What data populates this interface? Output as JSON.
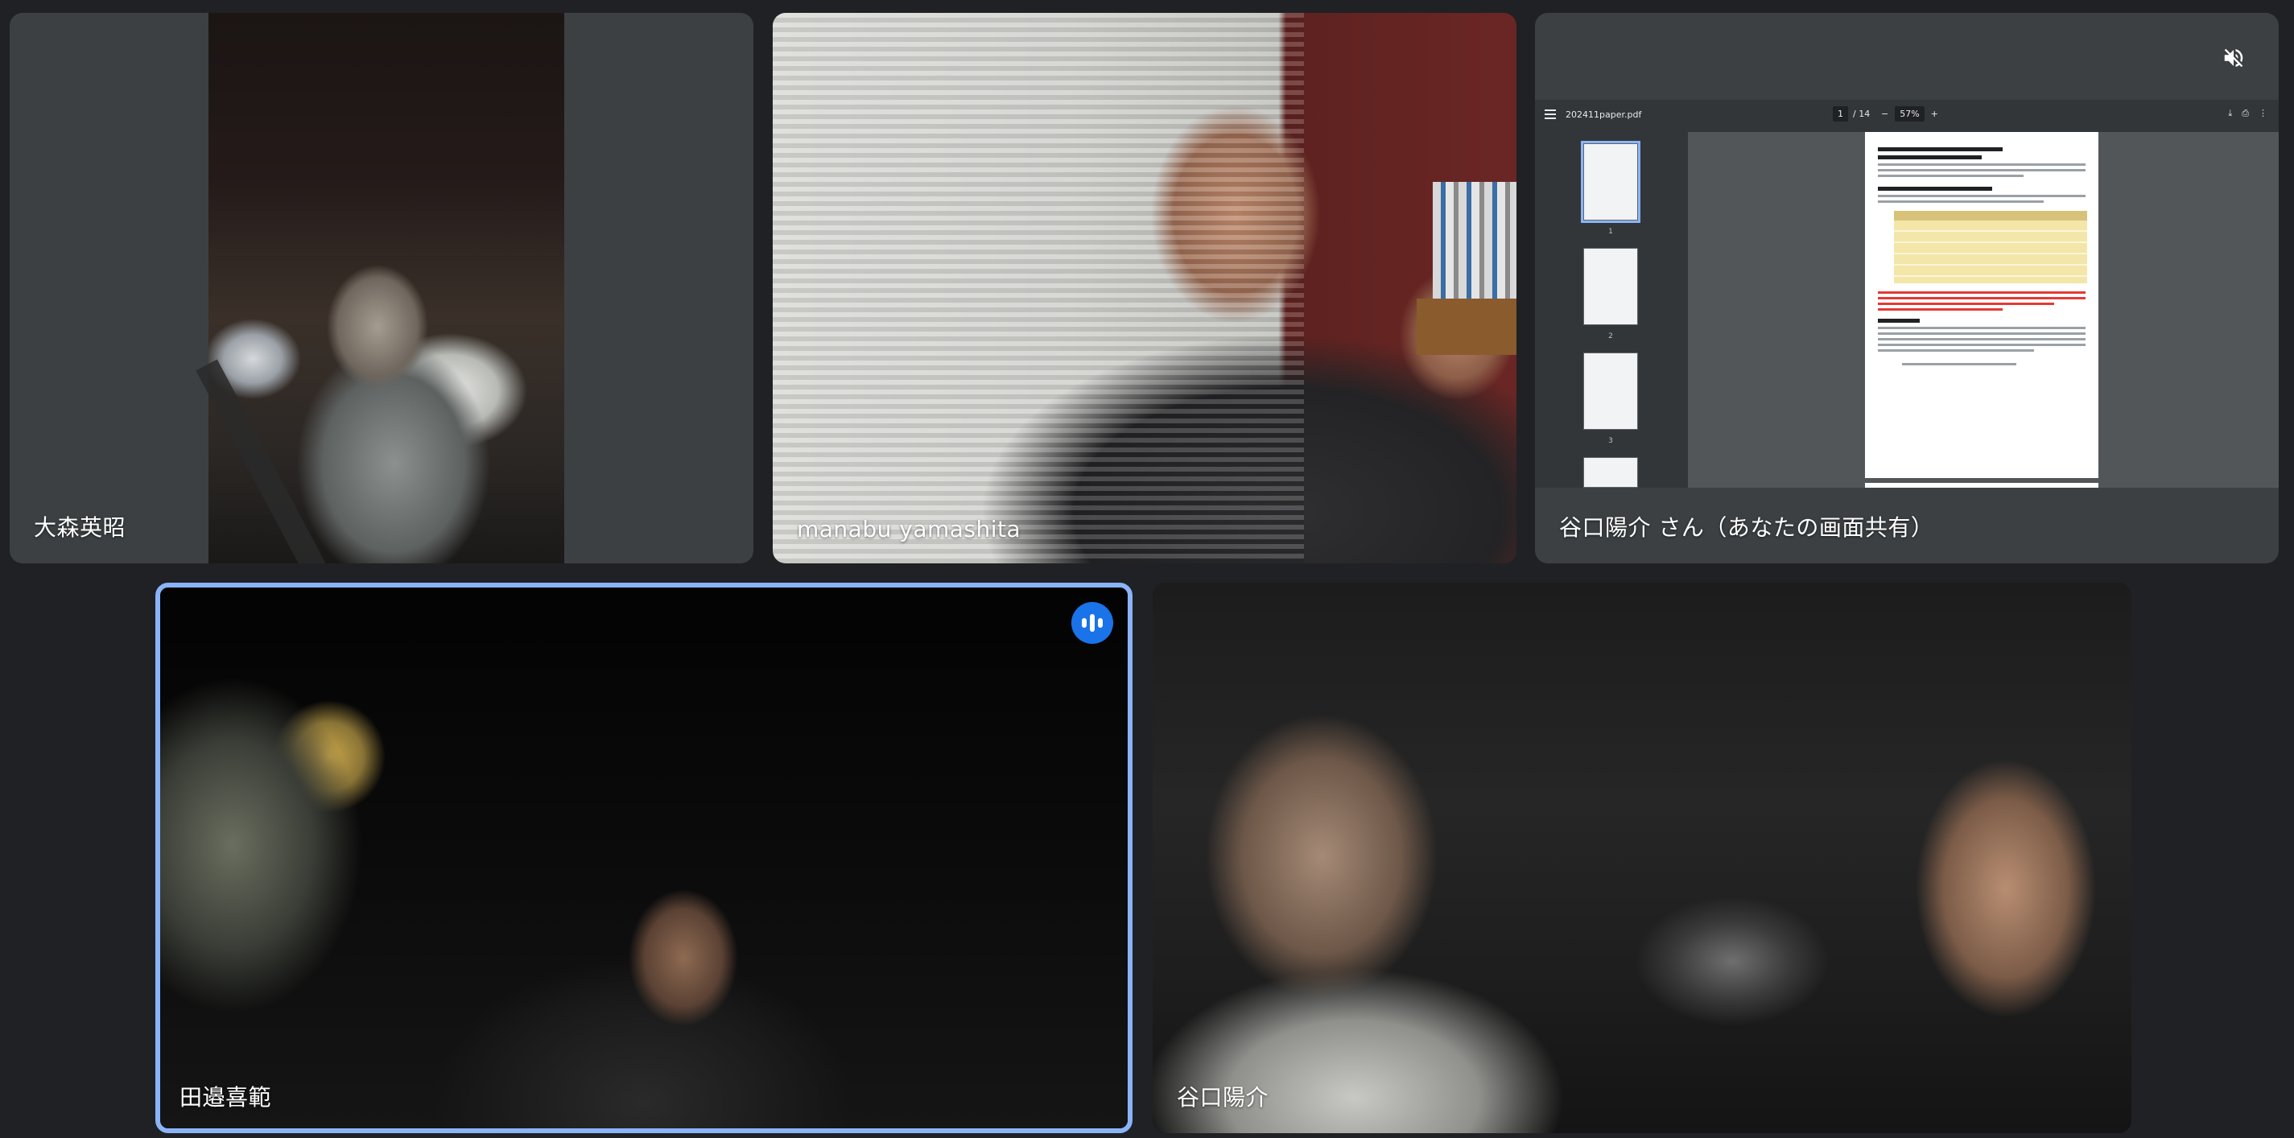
{
  "tiles": {
    "t1": {
      "name": "大森英昭"
    },
    "t2": {
      "name": "manabu yamashita"
    },
    "t3": {
      "name": "谷口陽介 さん（あなたの画面共有）",
      "pdf": {
        "filename": "202411paper.pdf",
        "page_current": "1",
        "page_total": "/ 14",
        "zoom": "57%",
        "thumbs": [
          "1",
          "2",
          "3"
        ]
      }
    },
    "t4": {
      "name": "田邉喜範"
    },
    "t5": {
      "name": "谷口陽介"
    }
  },
  "colors": {
    "background": "#202124",
    "tile": "#3c4043",
    "active_border": "#8ab4f8",
    "speaking_badge": "#1a73e8"
  },
  "icons": {
    "mute": "mic-muted-icon",
    "speaking": "audio-level-icon"
  }
}
